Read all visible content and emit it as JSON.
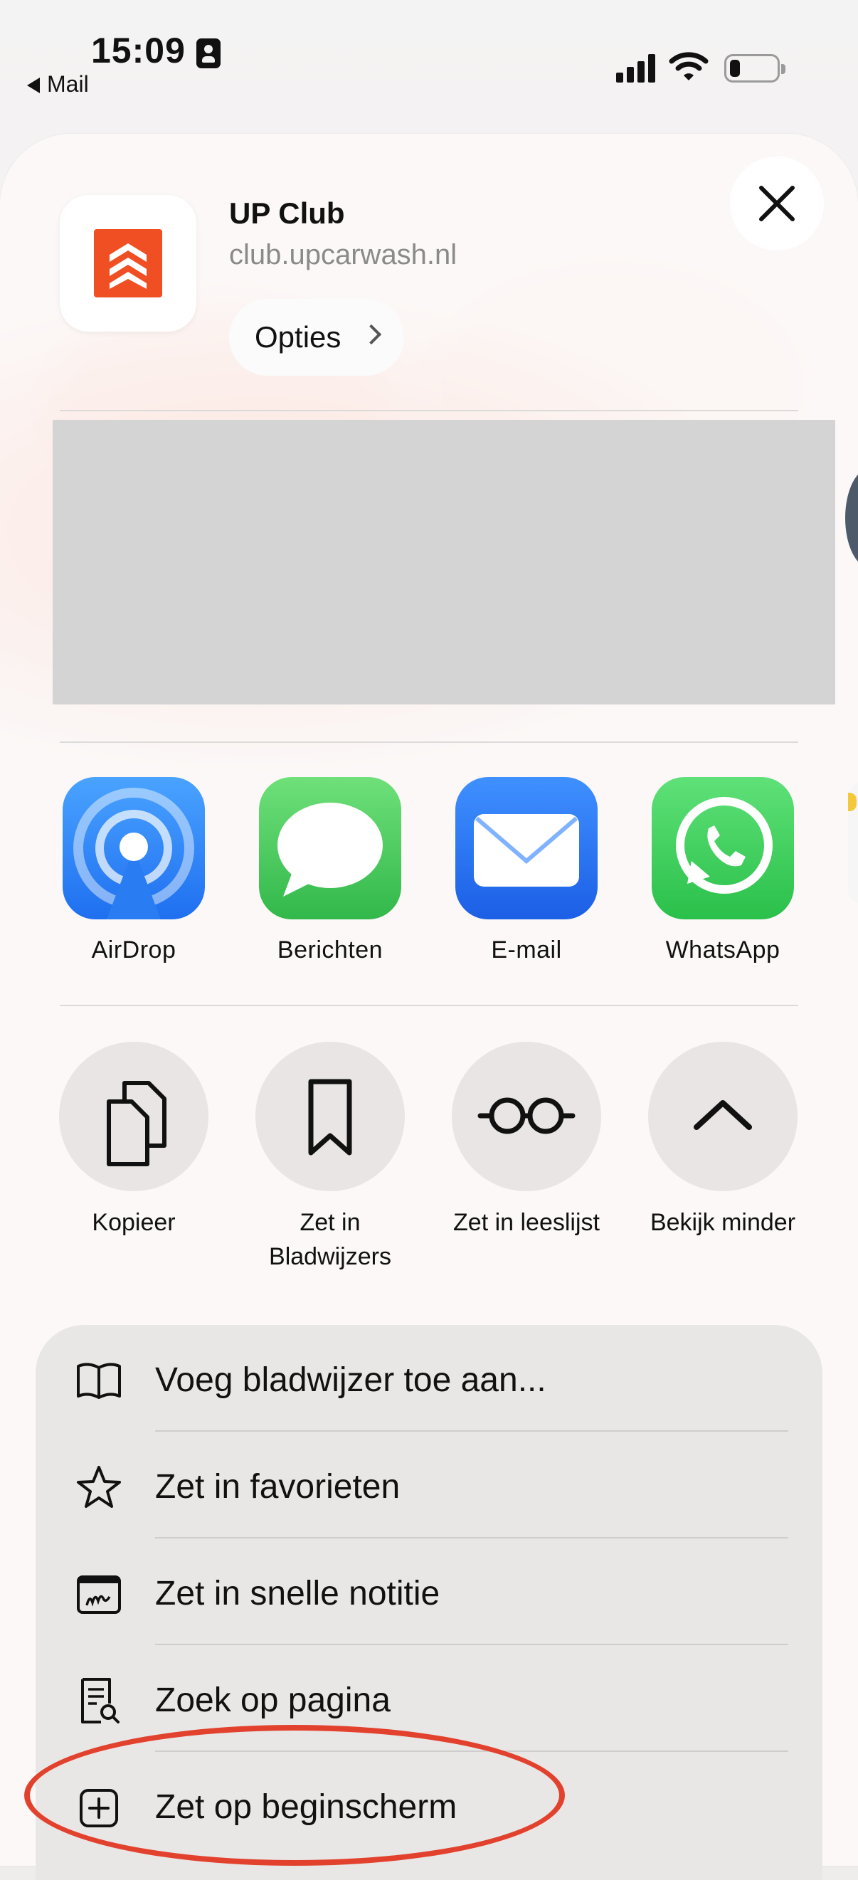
{
  "status_bar": {
    "time": "15:09",
    "back_app": "Mail"
  },
  "header": {
    "site_name": "UP Club",
    "site_url": "club.upcarwash.nl",
    "options_label": "Opties",
    "brand_color": "#f04e23"
  },
  "apps": [
    {
      "label": "AirDrop",
      "icon": "airdrop-icon"
    },
    {
      "label": "Berichten",
      "icon": "messages-icon"
    },
    {
      "label": "E-mail",
      "icon": "mail-icon"
    },
    {
      "label": "WhatsApp",
      "icon": "whatsapp-icon"
    }
  ],
  "actions": [
    {
      "label": "Kopieer",
      "icon": "copy-icon"
    },
    {
      "label": "Zet in Bladwijzers",
      "icon": "bookmark-icon"
    },
    {
      "label": "Zet in leeslijst",
      "icon": "reading-glasses-icon"
    },
    {
      "label": "Bekijk minder",
      "icon": "chevron-up-icon"
    }
  ],
  "menu": [
    {
      "label": "Voeg bladwijzer toe aan...",
      "icon": "book-icon"
    },
    {
      "label": "Zet in favorieten",
      "icon": "star-icon"
    },
    {
      "label": "Zet in snelle notitie",
      "icon": "quick-note-icon"
    },
    {
      "label": "Zoek op pagina",
      "icon": "find-on-page-icon"
    },
    {
      "label": "Zet op beginscherm",
      "icon": "add-square-icon"
    }
  ],
  "highlight_color": "#e2422d"
}
